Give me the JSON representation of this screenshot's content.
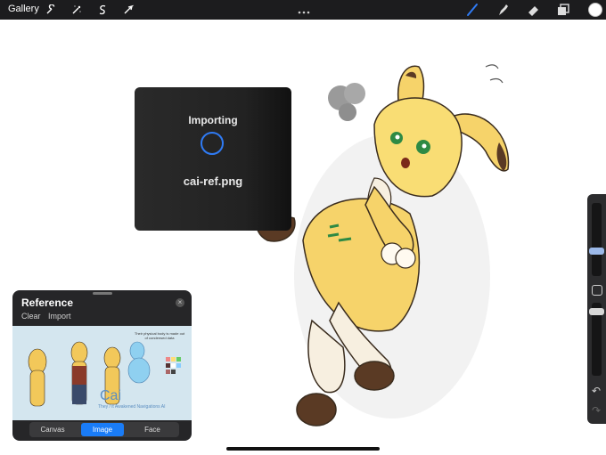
{
  "toolbar": {
    "gallery_label": "Gallery",
    "left_icons": [
      "wrench-icon",
      "magic-wand-icon",
      "selection-s-icon",
      "transform-arrow-icon"
    ],
    "right_icons": [
      "brush-icon",
      "smudge-icon",
      "eraser-icon",
      "layers-icon"
    ],
    "active_tool": "brush-icon",
    "current_color": "#ffffff",
    "accent": "#2f7bf5"
  },
  "import_dialog": {
    "title": "Importing",
    "filename": "cai-ref.png"
  },
  "reference": {
    "title": "Reference",
    "clear_label": "Clear",
    "import_label": "Import",
    "tabs": [
      {
        "label": "Canvas",
        "active": false
      },
      {
        "label": "Image",
        "active": true
      },
      {
        "label": "Face",
        "active": false
      }
    ],
    "image": {
      "name": "Cai",
      "subtitle": "They / it\nAwakened Navigations AI",
      "note": "Their physical body is made out of condensed data"
    }
  },
  "side_panel": {
    "undo_icon": "undo-icon",
    "redo_icon": "redo-icon"
  }
}
